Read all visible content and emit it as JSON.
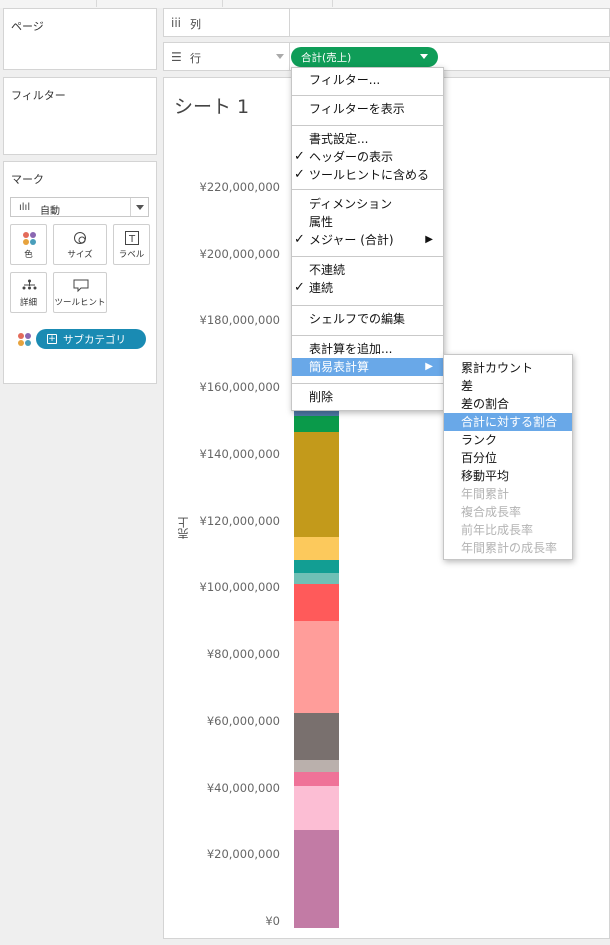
{
  "left_panel": {
    "pages_title": "ページ",
    "filters_title": "フィルター",
    "marks_title": "マーク",
    "mark_type": "自動",
    "mark_buttons": [
      "色",
      "サイズ",
      "ラベル",
      "詳細",
      "ツールヒント"
    ],
    "color_field": "サブカテゴリ"
  },
  "shelves": {
    "columns_label": "列",
    "rows_label": "行",
    "rows_pill": "合計(売上)"
  },
  "sheet": {
    "title": "シート 1",
    "y_axis_label": "売上"
  },
  "context_menu": {
    "groups": [
      [
        {
          "label": "フィルター...",
          "checked": false
        }
      ],
      [
        {
          "label": "フィルターを表示",
          "checked": false
        }
      ],
      [
        {
          "label": "書式設定...",
          "checked": false
        },
        {
          "label": "ヘッダーの表示",
          "checked": true
        },
        {
          "label": "ツールヒントに含める",
          "checked": true
        }
      ],
      [
        {
          "label": "ディメンション",
          "checked": false
        },
        {
          "label": "属性",
          "checked": false
        },
        {
          "label": "メジャー (合計)",
          "checked": true,
          "submenu": true
        }
      ],
      [
        {
          "label": "不連続",
          "checked": false
        },
        {
          "label": "連続",
          "checked": true
        }
      ],
      [
        {
          "label": "シェルフでの編集",
          "checked": false
        }
      ],
      [
        {
          "label": "表計算を追加...",
          "checked": false
        },
        {
          "label": "簡易表計算",
          "checked": false,
          "submenu": true,
          "highlighted": true
        }
      ],
      [
        {
          "label": "削除",
          "checked": false
        }
      ]
    ]
  },
  "submenu": {
    "items": [
      {
        "label": "累計カウント",
        "enabled": true
      },
      {
        "label": "差",
        "enabled": true
      },
      {
        "label": "差の割合",
        "enabled": true
      },
      {
        "label": "合計に対する割合",
        "enabled": true,
        "highlighted": true
      },
      {
        "label": "ランク",
        "enabled": true
      },
      {
        "label": "百分位",
        "enabled": true
      },
      {
        "label": "移動平均",
        "enabled": true
      },
      {
        "label": "年間累計",
        "enabled": false
      },
      {
        "label": "複合成長率",
        "enabled": false
      },
      {
        "label": "前年比成長率",
        "enabled": false
      },
      {
        "label": "年間累計の成長率",
        "enabled": false
      }
    ]
  },
  "chart_data": {
    "type": "bar",
    "stacked": true,
    "ylabel": "売上",
    "ylim": [
      0,
      225000000
    ],
    "ticks": [
      0,
      20000000,
      40000000,
      60000000,
      80000000,
      100000000,
      120000000,
      140000000,
      160000000,
      180000000,
      200000000,
      220000000
    ],
    "tick_labels": [
      "¥0",
      "¥20,000,000",
      "¥40,000,000",
      "¥60,000,000",
      "¥80,000,000",
      "¥100,000,000",
      "¥120,000,000",
      "¥140,000,000",
      "¥160,000,000",
      "¥180,000,000",
      "¥200,000,000",
      "¥220,000,000"
    ],
    "segments": [
      {
        "value": 29500000,
        "color": "#c27ba5"
      },
      {
        "value": 13000000,
        "color": "#fcbed4"
      },
      {
        "value": 4200000,
        "color": "#ef7298"
      },
      {
        "value": 3800000,
        "color": "#bab0ac"
      },
      {
        "value": 13800000,
        "color": "#79706e"
      },
      {
        "value": 27700000,
        "color": "#ff9d9a"
      },
      {
        "value": 11000000,
        "color": "#ff5a5a"
      },
      {
        "value": 3400000,
        "color": "#6fc0b5"
      },
      {
        "value": 3800000,
        "color": "#129e93"
      },
      {
        "value": 6900000,
        "color": "#fcc95c"
      },
      {
        "value": 31500000,
        "color": "#c39a1b"
      },
      {
        "value": 4800000,
        "color": "#0a9a4a"
      },
      {
        "value": 3300000,
        "color": "#4e79a7"
      }
    ]
  }
}
